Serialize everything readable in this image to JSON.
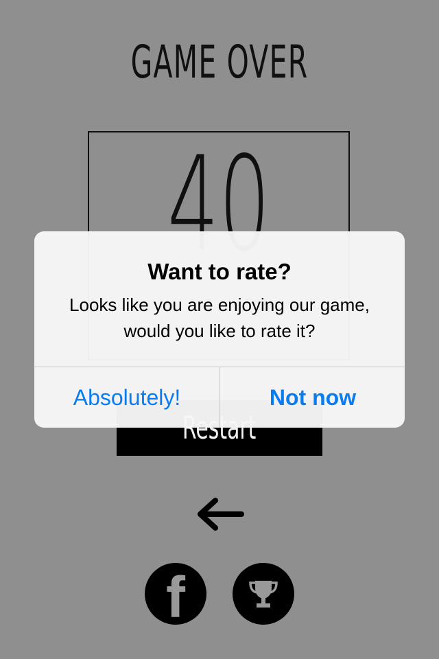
{
  "game": {
    "title": "GAME OVER",
    "score": "40",
    "restart_label": "Restart"
  },
  "icons": {
    "back": "left-arrow-icon",
    "facebook": "facebook-icon",
    "leaderboard": "trophy-icon"
  },
  "facebook_glyph": "f",
  "alert": {
    "title": "Want to rate?",
    "message": "Looks like you are enjoying our game, would you like to rate it?",
    "primary_label": "Absolutely!",
    "secondary_label": "Not now"
  },
  "colors": {
    "background": "#989898",
    "alert_button": "#0a7cf1"
  }
}
